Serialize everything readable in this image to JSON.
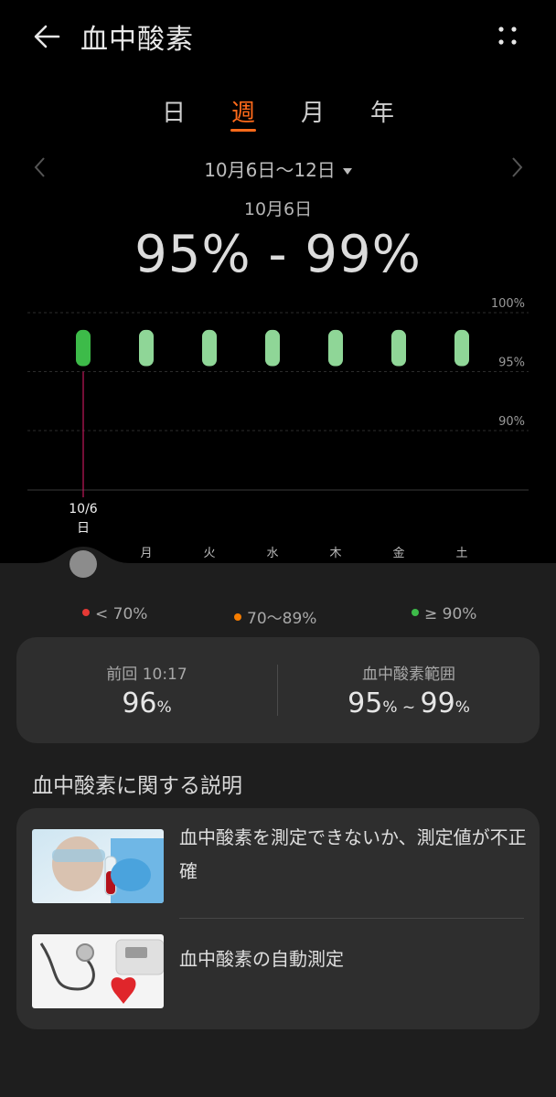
{
  "header": {
    "title": "血中酸素",
    "back_icon": "arrow-left-icon",
    "more_icon": "more-vertical-icon"
  },
  "tabs": [
    {
      "label": "日",
      "active": false
    },
    {
      "label": "週",
      "active": true
    },
    {
      "label": "月",
      "active": false
    },
    {
      "label": "年",
      "active": false
    }
  ],
  "range": {
    "label": "10月6日～12日",
    "selected_date": "10月6日",
    "value_text": "95% - 99%"
  },
  "colors": {
    "accent": "#ff6a1a",
    "bar_selected": "#3dbb49",
    "bar_normal": "#8fd697",
    "cursor_line": "#c2185b",
    "low": "#e53935",
    "mid": "#f57c00",
    "high": "#3dbb49"
  },
  "chart_data": {
    "type": "bar",
    "range_style": "min-max",
    "categories": [
      "日",
      "月",
      "火",
      "水",
      "木",
      "金",
      "土"
    ],
    "series": [
      {
        "min": [
          95,
          95,
          95,
          95,
          95,
          95,
          95
        ],
        "max": [
          99,
          99,
          99,
          99,
          99,
          99,
          99
        ]
      }
    ],
    "ylim": [
      85,
      100
    ],
    "yticks": [
      "100%",
      "95%",
      "90%"
    ],
    "ytick_values": [
      100,
      95,
      90
    ],
    "selected_index": 0,
    "selected_label_line1": "10/6",
    "selected_label_line2": "日",
    "grid": true
  },
  "legend": [
    {
      "label": "< 70%",
      "color": "#e53935"
    },
    {
      "label": "70～89%",
      "color": "#f57c00"
    },
    {
      "label": "≥ 90%",
      "color": "#3dbb49"
    }
  ],
  "stats": {
    "last": {
      "label": "前回 10:17",
      "value": "96",
      "unit": "%"
    },
    "range": {
      "label": "血中酸素範囲",
      "min": "95",
      "max": "99",
      "unit": "%",
      "separator": "~"
    }
  },
  "explanations": {
    "title": "血中酸素に関する説明",
    "items": [
      {
        "text": "血中酸素を測定できないか、測定値が不正確",
        "icon": "blood-sample-image"
      },
      {
        "text": "血中酸素の自動測定",
        "icon": "stethoscope-heart-image"
      }
    ]
  }
}
